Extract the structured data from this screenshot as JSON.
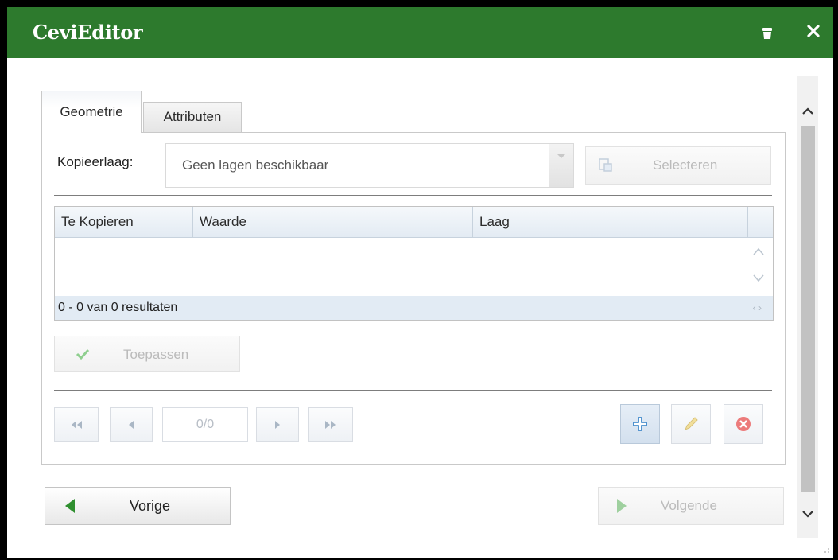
{
  "window": {
    "title": "CeviEditor"
  },
  "tabs": [
    {
      "label": "Geometrie",
      "active": true
    },
    {
      "label": "Attributen",
      "active": false
    }
  ],
  "copy_layer": {
    "label": "Kopieerlaag:",
    "value": "Geen lagen beschikbaar",
    "select_button": "Selecteren"
  },
  "grid": {
    "columns": [
      "Te Kopieren",
      "Waarde",
      "Laag"
    ],
    "rows": [],
    "footer": "0 - 0 van 0 resultaten"
  },
  "apply_button": "Toepassen",
  "pager": {
    "counter": "0/0"
  },
  "footer": {
    "prev": "Vorige",
    "next": "Volgende"
  },
  "colors": {
    "titlebar": "#2d7a2d",
    "accent_green": "#3a9a3a",
    "add_blue": "#2a7bc4",
    "delete_red": "#e05555"
  }
}
